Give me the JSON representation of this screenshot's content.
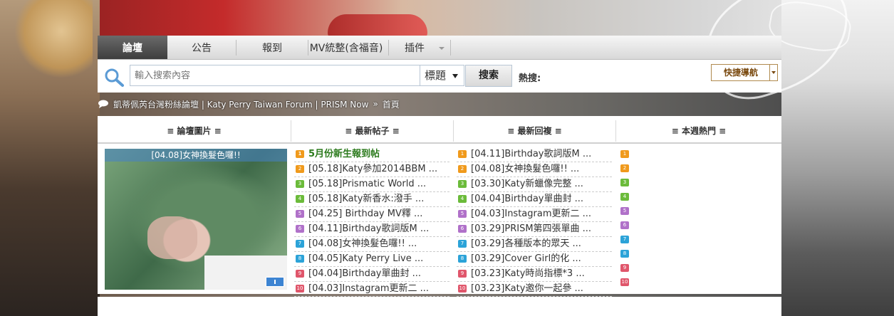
{
  "nav": {
    "items": [
      {
        "label": "論壇",
        "active": true
      },
      {
        "label": "公告"
      },
      {
        "label": "報到"
      },
      {
        "label": "MV統整(含福音)"
      },
      {
        "label": "插件"
      }
    ]
  },
  "search": {
    "placeholder": "輸入搜索內容",
    "type": "標題",
    "button": "搜索",
    "hot_label": "熱搜:",
    "quick_nav": "快捷導航"
  },
  "breadcrumb": {
    "forum": "凱蒂佩芮台灣粉絲論壇 | Katy Perry Taiwan Forum | PRISM Now",
    "separator": "»",
    "home": "首頁"
  },
  "columns": {
    "pics": "≡ 論壇圖片 ≡",
    "latest_posts": "≡ 最新帖子 ≡",
    "latest_replies": "≡ 最新回複 ≡",
    "weekly_hot": "≡ 本週熱門 ≡"
  },
  "photo": {
    "title": "[04.08]女神換髮色囉!!"
  },
  "latest_posts": [
    "5月份新生報到帖",
    "[05.18]Katy參加2014BBM ...",
    "[05.18]Prismatic World ...",
    "[05.18]Katy新香水:潑手 ...",
    "[04.25] Birthday MV釋 ...",
    "[04.11]Birthday歌詞版M ...",
    "[04.08]女神換髮色囉!! ...",
    "[04.05]Katy Perry Live ...",
    "[04.04]Birthday單曲封 ...",
    "[04.03]Instagram更新二 ..."
  ],
  "latest_replies": [
    "[04.11]Birthday歌詞版M ...",
    "[04.08]女神換髮色囉!! ...",
    "[03.30]Katy新蠟像完整 ...",
    "[04.04]Birthday單曲封 ...",
    "[04.03]Instagram更新二 ...",
    "[03.29]PRISM第四張單曲 ...",
    "[03.29]各種版本的眾天 ...",
    "[03.29]Cover Girl的化 ...",
    "[03.23]Katy時尚指標*3 ...",
    "[03.23]Katy邀你一起參 ..."
  ],
  "rank_numbers": [
    "1",
    "2",
    "3",
    "4",
    "5",
    "6",
    "7",
    "8",
    "9",
    "10"
  ]
}
